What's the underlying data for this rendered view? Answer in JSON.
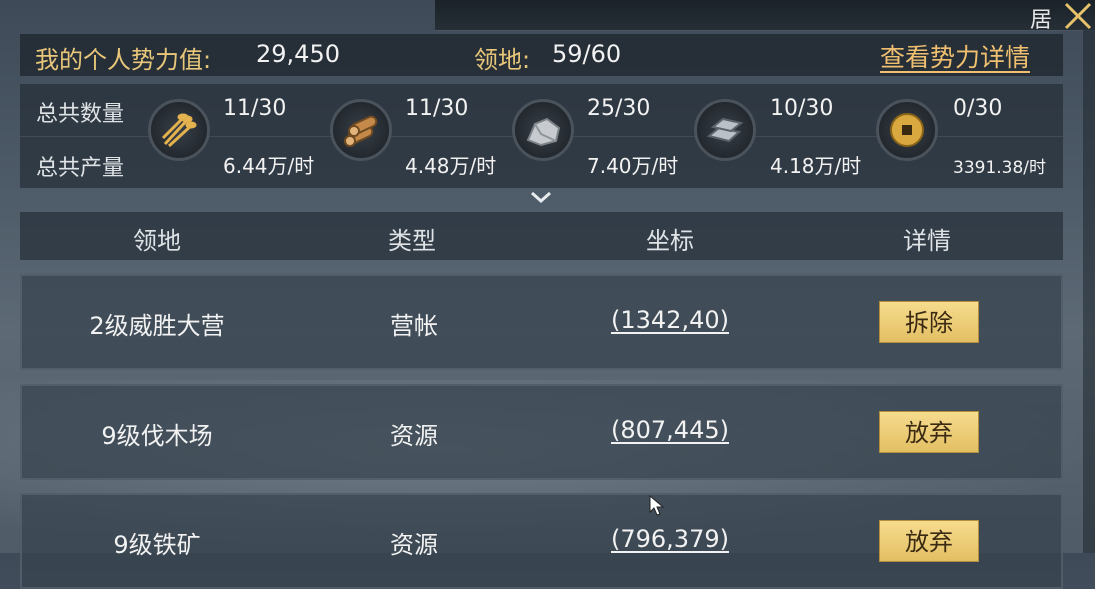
{
  "top_corner_char": "居",
  "header": {
    "power_label": "我的个人势力值:",
    "power_value": "29,450",
    "territory_label": "领地:",
    "territory_value": "59/60",
    "details_link": "查看势力详情"
  },
  "resources": {
    "count_label": "总共数量",
    "output_label": "总共产量",
    "items": [
      {
        "icon": "grain-icon",
        "count": "11/30",
        "rate": "6.44万/时"
      },
      {
        "icon": "wood-icon",
        "count": "11/30",
        "rate": "4.48万/时"
      },
      {
        "icon": "stone-icon",
        "count": "25/30",
        "rate": "7.40万/时"
      },
      {
        "icon": "iron-icon",
        "count": "10/30",
        "rate": "4.18万/时"
      },
      {
        "icon": "coin-icon",
        "count": "0/30",
        "rate": "3391.38/时"
      }
    ]
  },
  "table": {
    "headers": [
      "领地",
      "类型",
      "坐标",
      "详情"
    ],
    "rows": [
      {
        "name": "2级威胜大营",
        "type": "营帐",
        "coord": "(1342,40)",
        "action": "拆除"
      },
      {
        "name": "9级伐木场",
        "type": "资源",
        "coord": "(807,445)",
        "action": "放弃"
      },
      {
        "name": "9级铁矿",
        "type": "资源",
        "coord": "(796,379)",
        "action": "放弃"
      }
    ]
  },
  "colors": {
    "accent_gold": "#e9c77a",
    "button_gold": "#f0d27c",
    "link_orange": "#f0c070"
  }
}
